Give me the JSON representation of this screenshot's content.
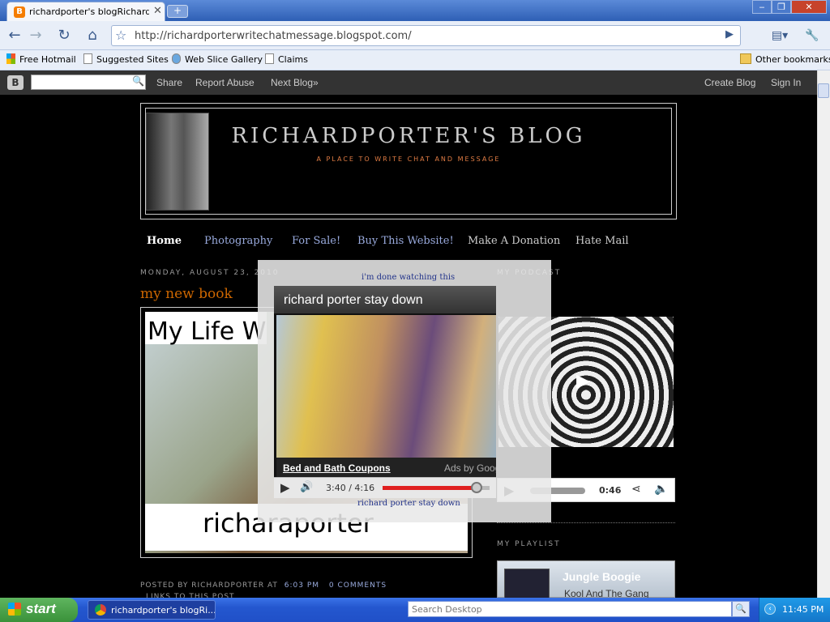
{
  "browser": {
    "tab_title": "richardporter's blogRichard...",
    "tab_favicon": "B",
    "new_tab": "+",
    "url": "http://richardporterwritechatmessage.blogspot.com/",
    "bookmarks": [
      "Free Hotmail",
      "Suggested Sites",
      "Web Slice Gallery",
      "Claims"
    ],
    "other_bookmarks": "Other bookmarks",
    "icons": [
      "back-icon",
      "forward-icon",
      "reload-icon",
      "home-icon",
      "star-icon",
      "go-icon",
      "page-menu-icon",
      "wrench-icon"
    ]
  },
  "blogger_nav": {
    "logo": "B",
    "links": [
      "Share",
      "Report Abuse",
      "Next Blog»"
    ],
    "right_links": [
      "Create Blog",
      "Sign In"
    ]
  },
  "blog": {
    "title": "RICHARDPORTER'S BLOG",
    "description": "A PLACE TO WRITE CHAT AND MESSAGE",
    "tabs": [
      "Home",
      "Photography",
      "For Sale!",
      "Buy This Website!",
      "Make A Donation",
      "Hate Mail"
    ]
  },
  "post": {
    "date": "MONDAY, AUGUST 23, 2010",
    "title": "my new book",
    "image_top_text": "My Life W",
    "image_bottom_text": "richaraporter",
    "posted_by": "POSTED BY RICHARDPORTER AT",
    "time": "6:03 PM",
    "comments": "0 COMMENTS",
    "links": "LINKS TO THIS POST"
  },
  "sidebar": {
    "podcast_heading": "MY PODCAST",
    "audio_time": "0:46",
    "audio_progress": 0.0,
    "playlist_heading": "MY PLAYLIST",
    "playlist_title": "Jungle Boogie",
    "playlist_artist": "Kool And The Gang"
  },
  "overlay": {
    "top_link": "i'm done watching this",
    "video_title": "richard porter stay down",
    "ad_link": "Bed and Bath Coupons",
    "ad_label": "Ads by Google",
    "time": "3:40 / 4:16",
    "progress": 0.88,
    "bottom_link": "richard porter stay down"
  },
  "taskbar": {
    "start": "start",
    "task_item": "richardporter's blogRi...",
    "search_placeholder": "Search Desktop",
    "clock": "11:45 PM"
  }
}
